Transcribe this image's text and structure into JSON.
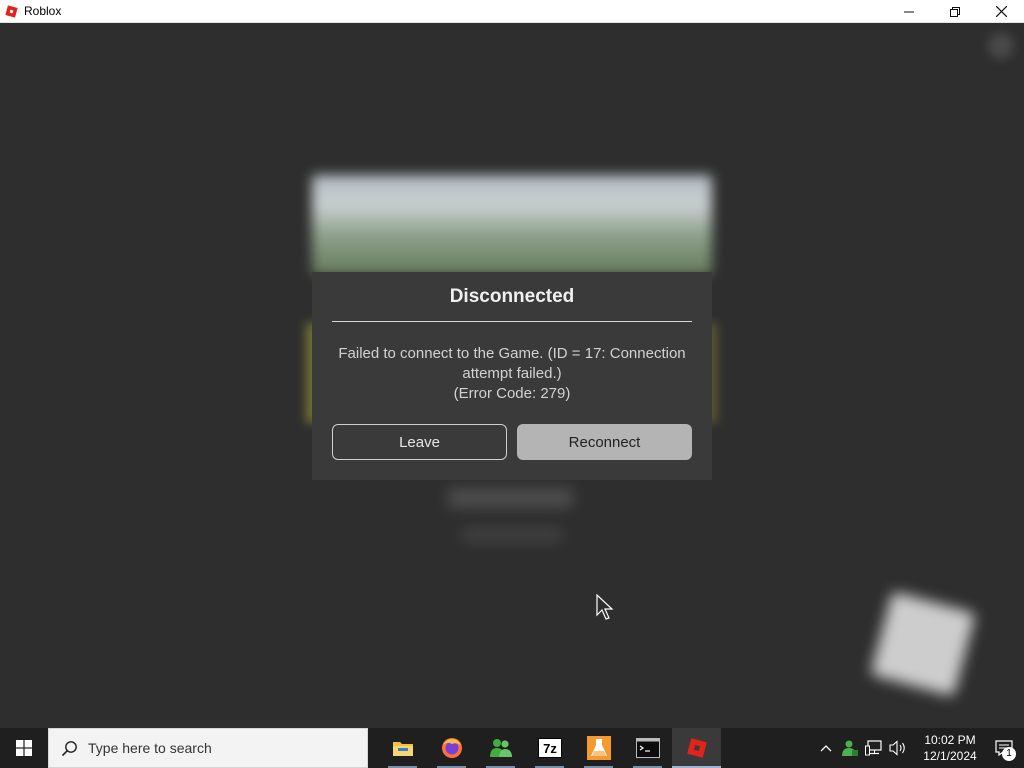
{
  "window": {
    "title": "Roblox",
    "brand_color": "#e2231a",
    "icons": {
      "app": "roblox-icon",
      "minimize": "minimize-icon",
      "restore": "restore-icon",
      "close": "close-icon"
    }
  },
  "dialog": {
    "title": "Disconnected",
    "message_line1": "Failed to connect to the Game. (ID = 17: Connection",
    "message_line2": "attempt failed.)",
    "message_line3": "(Error Code: 279)",
    "leave_label": "Leave",
    "reconnect_label": "Reconnect"
  },
  "taskbar": {
    "search_placeholder": "Type here to search",
    "apps": [
      {
        "name": "file-explorer",
        "icon": "folder-icon"
      },
      {
        "name": "firefox",
        "icon": "firefox-icon"
      },
      {
        "name": "messenger",
        "icon": "people-icon"
      },
      {
        "name": "7-zip",
        "icon": "7zip-icon",
        "label": "7z"
      },
      {
        "name": "lab",
        "icon": "flask-icon"
      },
      {
        "name": "terminal",
        "icon": "terminal-icon"
      },
      {
        "name": "roblox",
        "icon": "roblox-icon",
        "active": true
      }
    ],
    "tray": {
      "icons": [
        "chevron-up-icon",
        "user-network-icon",
        "network-icon",
        "speaker-icon"
      ],
      "time": "10:02 PM",
      "date": "12/1/2024",
      "notification_count": "1"
    }
  }
}
